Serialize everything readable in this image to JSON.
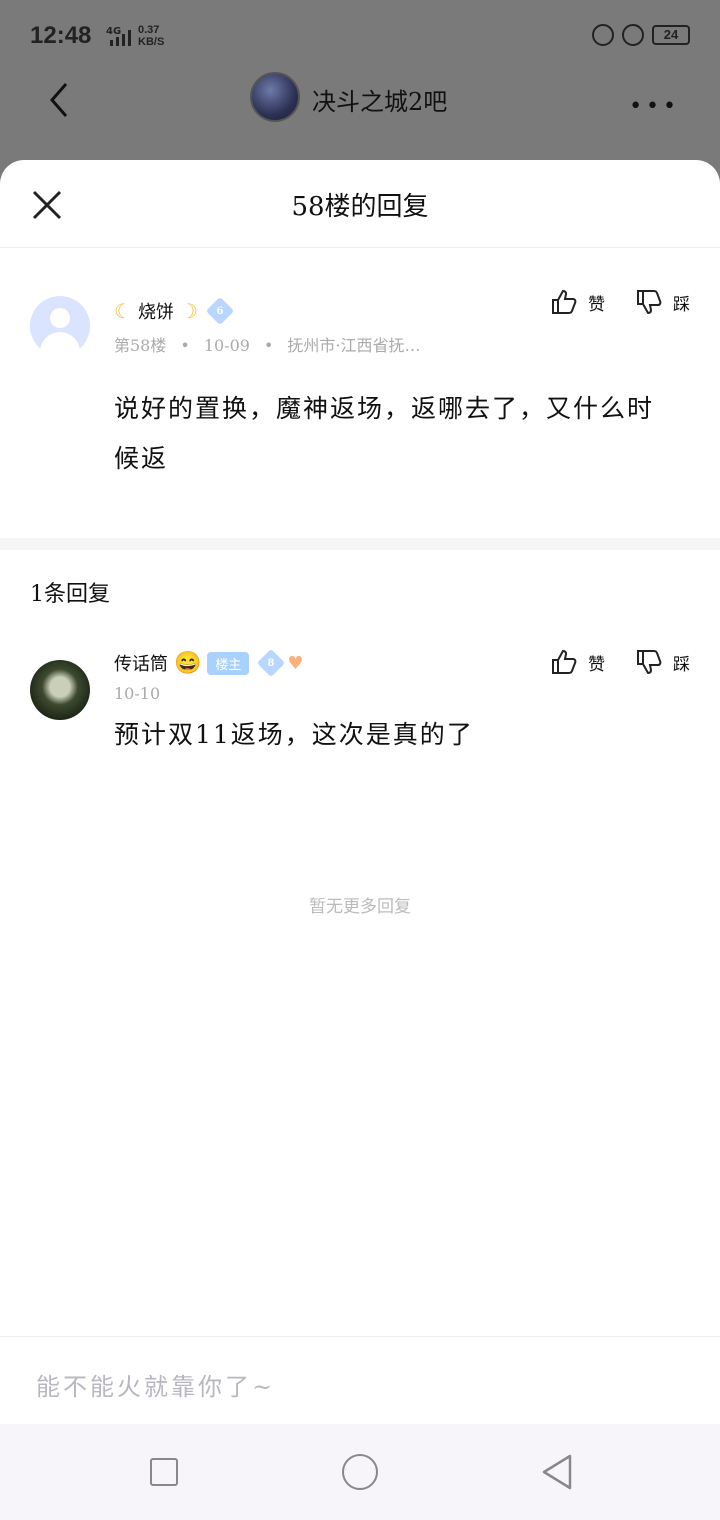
{
  "status_bar": {
    "time": "12:48",
    "network": "4G",
    "speed": "0.37",
    "speed_unit": "KB/S",
    "battery": "24"
  },
  "header": {
    "forum_name": "决斗之城2吧"
  },
  "sheet": {
    "title": "58楼的回复"
  },
  "post": {
    "username": "烧饼",
    "level": "6",
    "floor": "第58楼",
    "date": "10-09",
    "location": "抚州市·江西省抚…",
    "like_label": "赞",
    "dislike_label": "踩",
    "content": "说好的置换，魔神返场，返哪去了，又什么时候返"
  },
  "replies_header": {
    "count_label": "1条回复"
  },
  "replies": [
    {
      "username": "传话筒",
      "emoji": "😄",
      "owner_tag": "楼主",
      "level": "8",
      "date": "10-10",
      "like_label": "赞",
      "dislike_label": "踩",
      "content": "预计双11返场，这次是真的了"
    }
  ],
  "no_more": "暂无更多回复",
  "input": {
    "placeholder": "能不能火就靠你了~"
  },
  "colors": {
    "accent_badge": "#a9d1ff",
    "muted_text": "#aaaaaa"
  }
}
